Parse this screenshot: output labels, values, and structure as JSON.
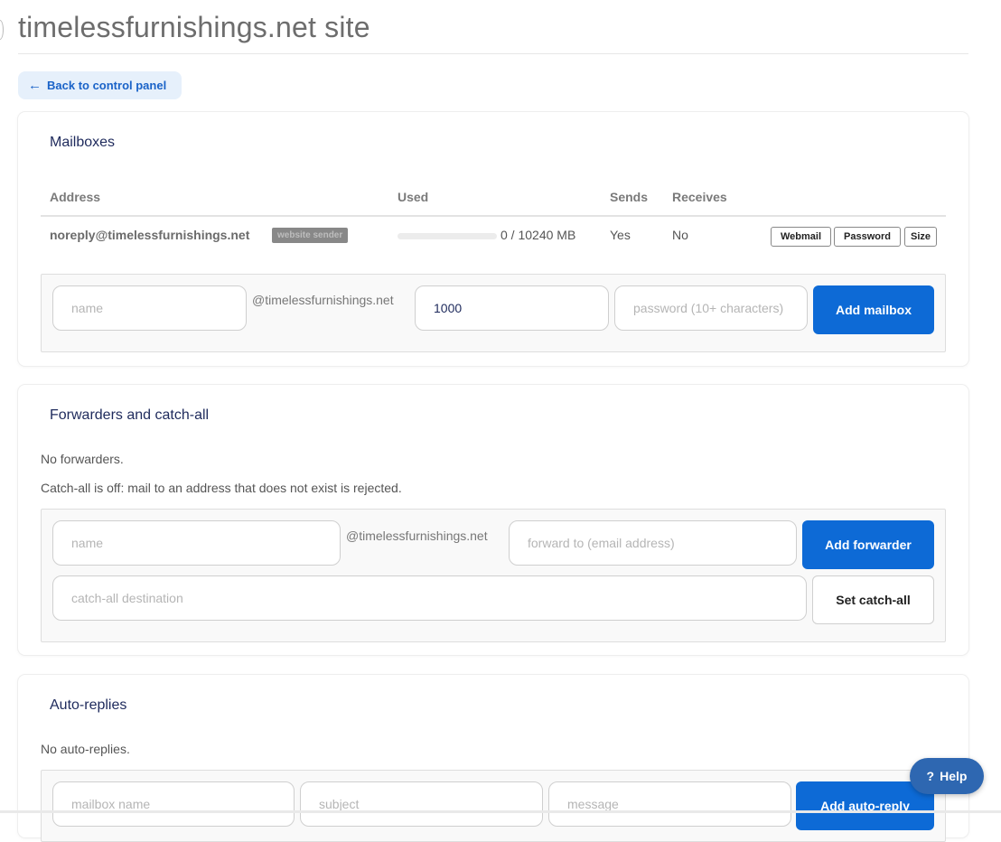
{
  "page": {
    "title": "timelessfurnishings.net site",
    "back_label": "Back to control panel",
    "back_icon": "arrow-left-icon"
  },
  "colors": {
    "accent": "#0d6ad6",
    "title": "#1e2a5c",
    "back_bg": "#e6f0fb"
  },
  "mailboxes": {
    "heading": "Mailboxes",
    "columns": [
      "Address",
      "Used",
      "Sends",
      "Receives"
    ],
    "rows": [
      {
        "address": "noreply@timelessfurnishings.net",
        "badge": "website sender",
        "used_fraction": 0,
        "used_text": "0 / 10240 MB",
        "sends": "Yes",
        "receives": "No",
        "actions": [
          "Webmail",
          "Password",
          "Size"
        ]
      }
    ],
    "form": {
      "name_placeholder": "name",
      "domain_suffix": "@timelessfurnishings.net",
      "size_value": "1000",
      "password_placeholder": "password (10+ characters)",
      "submit_label": "Add mailbox"
    }
  },
  "forwarders": {
    "heading": "Forwarders and catch-all",
    "empty_text": "No forwarders.",
    "catchall_text": "Catch-all is off: mail to an address that does not exist is rejected.",
    "form": {
      "name_placeholder": "name",
      "domain_suffix": "@timelessfurnishings.net",
      "forward_placeholder": "forward to (email address)",
      "submit_label": "Add forwarder",
      "catchall_placeholder": "catch-all destination",
      "catchall_label": "Set catch-all"
    }
  },
  "autoreplies": {
    "heading": "Auto-replies",
    "empty_text": "No auto-replies.",
    "form": {
      "mailbox_placeholder": "mailbox name",
      "subject_placeholder": "subject",
      "message_placeholder": "message",
      "submit_label": "Add auto-reply"
    }
  },
  "help": {
    "icon": "?",
    "label": "Help"
  }
}
